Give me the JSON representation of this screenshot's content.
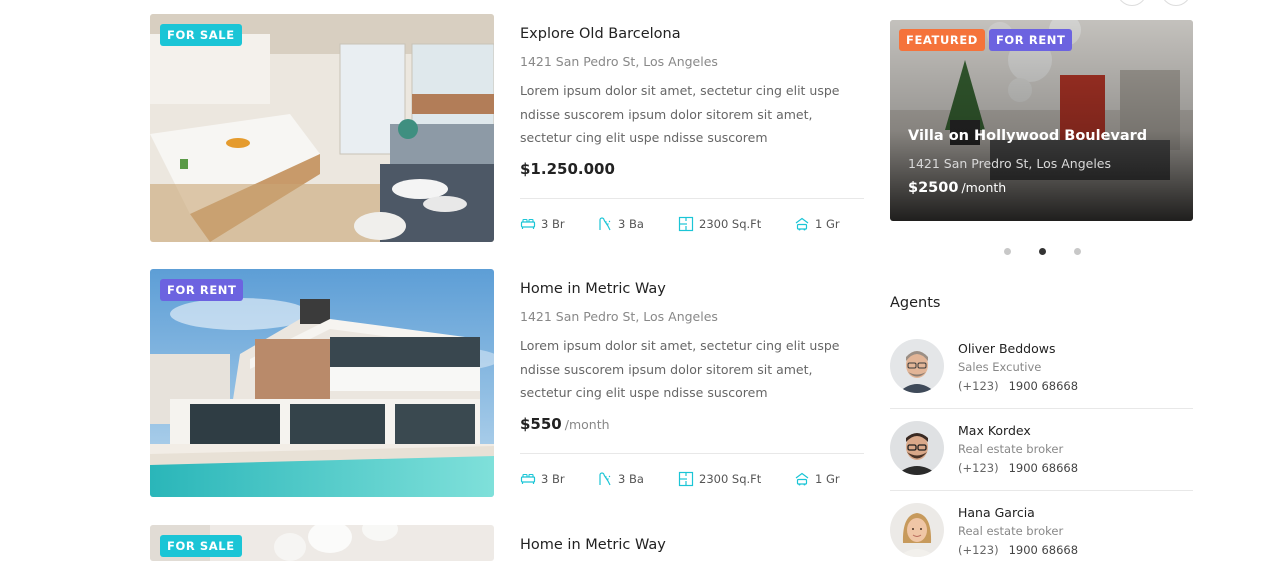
{
  "listings": [
    {
      "badge": "FOR SALE",
      "title": "Explore Old Barcelona",
      "address": "1421 San Pedro St, Los Angeles",
      "description": "Lorem ipsum dolor sit amet, sectetur cing elit uspe ndisse suscorem ipsum dolor sitorem sit amet, sectetur cing elit uspe ndisse suscorem",
      "price": "$1.250.000",
      "period": "",
      "features": {
        "beds": "3 Br",
        "baths": "3 Ba",
        "area": "2300 Sq.Ft",
        "garage": "1 Gr"
      }
    },
    {
      "badge": "FOR RENT",
      "title": "Home in Metric Way",
      "address": "1421 San Pedro St, Los Angeles",
      "description": "Lorem ipsum dolor sit amet, sectetur cing elit uspe ndisse suscorem ipsum dolor sitorem sit amet, sectetur cing elit uspe ndisse suscorem",
      "price": "$550",
      "period": "/month",
      "features": {
        "beds": "3 Br",
        "baths": "3 Ba",
        "area": "2300 Sq.Ft",
        "garage": "1 Gr"
      }
    },
    {
      "badge": "FOR SALE",
      "title": "Home in Metric Way"
    }
  ],
  "featured": {
    "badges": [
      "FEATURED",
      "FOR RENT"
    ],
    "title": "Villa on Hollywood Boulevard",
    "address": "1421 San Predro St, Los Angeles",
    "price": "$2500",
    "period": "/month",
    "slides_total": 3,
    "active_slide": 2
  },
  "agents": {
    "title": "Agents",
    "items": [
      {
        "name": "Oliver Beddows",
        "role": "Sales Excutive",
        "phone_code": "(+123)",
        "phone_number": "1900 68668"
      },
      {
        "name": "Max Kordex",
        "role": "Real estate broker",
        "phone_code": "(+123)",
        "phone_number": "1900 68668"
      },
      {
        "name": "Hana Garcia",
        "role": "Real estate broker",
        "phone_code": "(+123)",
        "phone_number": "1900 68668"
      }
    ]
  },
  "colors": {
    "sale_badge": "#1bc5d6",
    "rent_badge": "#6c63e0",
    "featured_badge": "#f5733b",
    "feature_icon": "#1bc5d6"
  },
  "icons": {
    "beds": "bed-icon",
    "baths": "bath-icon",
    "area": "floorplan-icon",
    "garage": "car-icon"
  }
}
